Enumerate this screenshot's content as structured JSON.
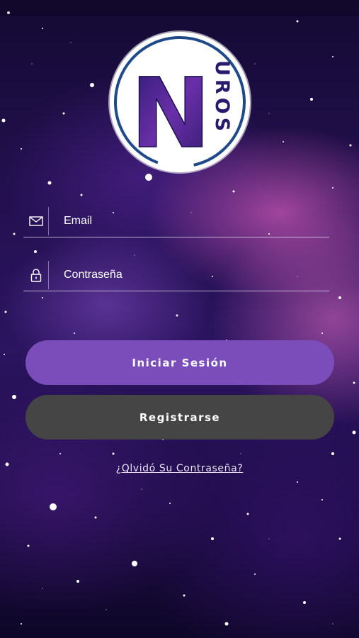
{
  "colors": {
    "accent_button": "#7b4dbb",
    "secondary_button": "#454545",
    "logo_ring": "#1f4a8a",
    "text": "#ffffff"
  },
  "logo": {
    "letter": "N",
    "word": "UROS"
  },
  "form": {
    "email": {
      "icon": "mail-icon",
      "placeholder": "Email",
      "value": ""
    },
    "password": {
      "icon": "lock-icon",
      "placeholder": "Contraseña",
      "value": ""
    }
  },
  "buttons": {
    "login_label": "Iniciar Sesión",
    "register_label": "Registrarse"
  },
  "links": {
    "forgot_password": "¿Olvidó Su Contraseña?"
  }
}
